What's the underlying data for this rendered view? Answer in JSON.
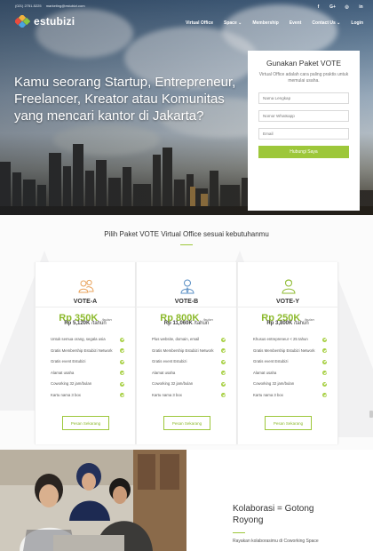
{
  "topbar": {
    "phone": "(021) 2751-5225",
    "email": "marketing@estubizi.com"
  },
  "social": [
    "f",
    "G+",
    "◎",
    "in"
  ],
  "brand": {
    "name": "estubizi"
  },
  "nav": [
    "Virtual Office",
    "Space ⌄",
    "Membership",
    "Event",
    "Contact Us ⌄",
    "Login"
  ],
  "hero": {
    "headline": "Kamu seorang Startup, Entrepreneur, Freelancer, Kreator atau Komunitas yang mencari kantor di Jakarta?"
  },
  "form": {
    "title": "Gunakan Paket VOTE",
    "subtitle": "Virtual Office adalah cara paling praktis untuk memulai usaha.",
    "name_placeholder": "Nama Lengkap",
    "phone_placeholder": "Nomor Whatsapp",
    "email_placeholder": "Email",
    "submit": "Hubungi Saya"
  },
  "pricing": {
    "title": "Pilih Paket VOTE Virtual Office sesuai kebutuhanmu",
    "plans": [
      {
        "name": "VOTE-A",
        "price": "Rp 350K",
        "per": "/bulan",
        "yearly": "Rp 5,120K",
        "yearly_per": "/tahun",
        "features": [
          "Untuk semua orang, segala usia",
          "Gratis Membership Estubizi Network",
          "Gratis event Estubizi",
          "Alamat usaha",
          "Coworking 32 jam/bulan",
          "Kartu nama 3 box"
        ],
        "button": "Pesan Sekarang",
        "icon": "users-icon"
      },
      {
        "name": "VOTE-B",
        "price": "Rp 800K",
        "per": "/bulan",
        "yearly": "Rp 11,060K",
        "yearly_per": "/tahun",
        "features": [
          "Plus website, domain, email",
          "Gratis Membership Estubizi Network",
          "Gratis event Estubizi",
          "Alamat usaha",
          "Coworking 32 jam/bulan",
          "Kartu nama 3 box"
        ],
        "button": "Pesan Sekarang",
        "icon": "user-icon"
      },
      {
        "name": "VOTE-Y",
        "price": "Rp 250K",
        "per": "/bulan",
        "yearly": "Rp 3,800K",
        "yearly_per": "/tahun",
        "features": [
          "Khusus entrepreneur < 25 tahun",
          "Gratis Membership Estubizi Network",
          "Gratis event Estubizi",
          "Alamat usaha",
          "Coworking 32 jam/bulan",
          "Kartu nama 3 box"
        ],
        "button": "Pesan Sekarang",
        "icon": "young-user-icon"
      }
    ]
  },
  "collab": {
    "title": "Kolaborasi = Gotong Royong",
    "text": "Rayakan kolaborasimu di Coworking Space"
  },
  "colors": {
    "accent": "#9dc73a",
    "icon_orange": "#e9a35c",
    "icon_blue": "#5a8fc4",
    "icon_green": "#8dba2e"
  }
}
